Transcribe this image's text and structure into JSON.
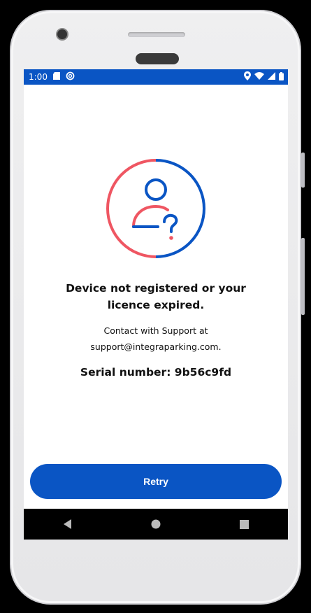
{
  "status_bar": {
    "time": "1:00",
    "left_icons": [
      "sd-card-icon",
      "sync-icon"
    ],
    "right_icons": [
      "location-icon",
      "wifi-icon",
      "signal-icon",
      "battery-icon"
    ],
    "color": "#0a55c4"
  },
  "message": {
    "title_line1": "Device not registered or your",
    "title_line2": "licence expired.",
    "contact_line1": "Contact with Support at",
    "contact_line2": "support@integraparking.com.",
    "serial": "Serial number: 9b56c9fd"
  },
  "illustration": {
    "icon": "user-question-icon",
    "accent_red": "#ef5662",
    "accent_blue": "#0a55c4"
  },
  "retry_button": {
    "label": "Retry",
    "color": "#0a55c4"
  },
  "nav_bar": {
    "buttons": [
      "back-icon",
      "home-icon",
      "recents-icon"
    ]
  }
}
